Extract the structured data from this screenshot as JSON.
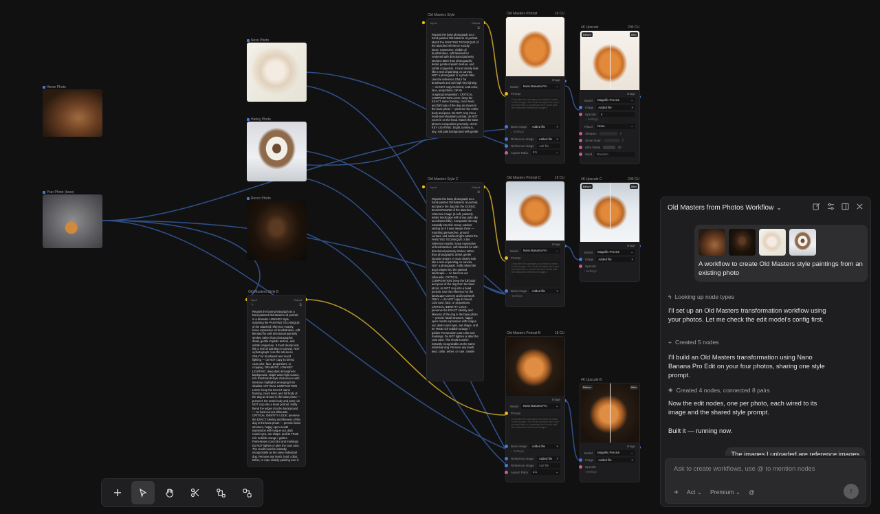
{
  "image_nodes": [
    {
      "id": "horse",
      "label": "Horse Photo"
    },
    {
      "id": "photo",
      "label": "Your Photo (base)"
    },
    {
      "id": "borzoi",
      "label": "Nexo Photo"
    },
    {
      "id": "sheltie",
      "label": "Harley Photo"
    },
    {
      "id": "boxer",
      "label": "Rocco Photo"
    }
  ],
  "style_nodes": [
    {
      "title": "Old Masters Style",
      "input_label": "Input",
      "output_label": "Output",
      "text": "Repaint the base photograph as a hand-painted Old Masters oil portrait. Match the PAINTING TECHNIQUE of the attached reference exactly: loose, expressive, visible oil brushstrokes, soft blended fur rendered with directional painterly strokes rather than photographic detail, gentle impasto texture, and subtle craquelure. It must clearly look like a real oil painting on canvas, NOT a photograph or a photo filter. Use the reference ONLY for brushwork and soft high-key lighting — do NOT copy its breed, coat color, face, proportions. OR its cropping/composition. CRITICAL COMPOSITION LOCK: keep the EXACT same framing, zoom level, and full body of the dog as shown in the base photo — preserve the entire body and pose. Do NOT crop into a head-and-shoulders portrait, do NOT zoom in on the head. Match the base photo's composition precisely. HIGH-KEY LIGHTING: bright, luminous, airy, soft pale background with gentle"
    },
    {
      "title": "Old Masters Style C",
      "input_label": "Input",
      "output_label": "Output",
      "text": "Repaint the base photograph as a hand-painted Old Masters oil portrait, and place the dog into the SCENIC BACKGROUND of the attached reference image (a soft, painterly winter landscape with snow, pale sky and distant hills). Composite the dog naturally into this snowy outdoor setting as if it was always there — matching perspective, ground contact, and ambient light. Match the PAINTING TECHNIQUE of the reference exactly: loose expressive oil brushstrokes, soft blended fur with directional painterly strokes rather than photographic detail, gentle impasto texture. It must clearly look like a real oil painting on canvas, NOT a photograph. Softly blend the dog's edges into the painted landscape — no hard cut-out silhouette. CRITICAL COMPOSITION: keep the full body and pose of the dog from the base photo; do NOT crop into a head portrait. Use the reference for the landscape scenery and brushwork ONLY — do NOT copy its breed, coat color, face, or proportions. CRITICAL IDENTITY LOCK: preserve the EXACT identity and likeness of the dog in the base photo — precise facial structure, happy open-mouth expression with tongue out, dark round eyes, ear shape, and its TRUE rich reddish-orange / golden Pomeranian coat color and markings. Do NOT lighten or alter the coat color. The result must be instantly recognizable as the same individual dog. Remove any leash, lead, collar, tether, or rope, cleanly painting over it."
    },
    {
      "title": "Old Masters Style B",
      "input_label": "Input",
      "output_label": "Output",
      "text": "Repaint the base photograph as a hand-painted Old Masters oil portrait in a dramatic LOW-KEY style, matching the PAINTING TECHNIQUE of the attached reference exactly: loose expressive oil brushstrokes, soft blended fur with directional painterly strokes rather than photographic detail, gentle impasto texture, and subtle craquelure. It must clearly look like a real oil painting on canvas, NOT a photograph. Use the reference ONLY for brushwork and mood lighting — do NOT copy its breed, coat color, face, proportions, or cropping. DRAMATIC LOW-KEY LIGHTING: deep dark atmospheric background, single warm light source, rich Rembrandt-style chiaroscuro with luminous highlights emerging from shadow. CRITICAL COMPOSITION LOCK: keep the EXACT same framing, zoom level, and full body of the dog as shown in the base photo — preserve the entire body and pose; do NOT crop into a head portrait. Softly blend the edges into the background — no hard cut-out silhouette. CRITICAL IDENTITY LOCK: preserve the EXACT identity and likeness of the dog in the base photo — precise facial structure, happy open-mouth expression with tongue out, dark round eyes, ear shape, and its TRUE rich reddish-orange / golden Pomeranian coat color and markings. Do NOT lighten or alter the coat color. The result must be instantly recognizable as the same individual dog. Remove any leash, lead, collar, tether, or rope cleanly painting over it."
    }
  ],
  "edit_nodes": [
    {
      "title": "Old Masters Portrait",
      "cost": "18 CU",
      "image_label": "Image",
      "model_label": "Model",
      "model": "Nano Banana Pro",
      "prompt_label": "Prompt",
      "prompt_placeholder": "Describe the changes you want to make to the image. The node accepts the input prompt from a connected text node and the attached reference images.",
      "base_label": "Base Image",
      "base_value": "Added file",
      "settings_label": "Settings",
      "ref1_label": "Reference Image",
      "ref1_value": "Added file",
      "ref2_label": "Reference Image",
      "ref2_value": "Add file",
      "aspect_label": "Aspect Ratio",
      "aspect_value": "1:1"
    },
    {
      "title": "Old Masters Portrait C",
      "cost": "18 CU",
      "image_label": "Image",
      "model_label": "Model",
      "model": "Nano Banana Pro",
      "prompt_label": "Prompt",
      "prompt_placeholder": "Describe the changes you want to make to the image. The node accepts the input prompt from a connected text node and the attached reference images.",
      "base_label": "Base Image",
      "base_value": "Added file",
      "settings_label": "Settings"
    },
    {
      "title": "Old Masters Portrait B",
      "cost": "18 CU",
      "image_label": "Image",
      "model_label": "Model",
      "model": "Nano Banana Pro",
      "prompt_label": "Prompt",
      "prompt_placeholder": "Describe the changes you want to make to the image. The node accepts the input prompt from a connected text node and the attached reference images.",
      "base_label": "Base Image",
      "base_value": "Added file",
      "settings_label": "Settings",
      "ref1_label": "Reference Image",
      "ref1_value": "Added file",
      "ref2_label": "Reference Image",
      "ref2_value": "Add file",
      "aspect_label": "Aspect Ratio",
      "aspect_value": "1:1"
    }
  ],
  "upscale_nodes": [
    {
      "title": "4K Upscale",
      "cost": "200 CU",
      "before": "Before",
      "after": "After",
      "image_label": "Image",
      "model_label": "Model",
      "model": "Magnific Precise",
      "input_label": "Image",
      "input_value": "Added file",
      "upscale_label": "Upscale",
      "upscale_value": "4",
      "settings_label": "Settings",
      "flavor_label": "Flavor",
      "flavor_value": "None",
      "sharpen_label": "Sharpen",
      "sharpen_value": "7",
      "smart_grain_label": "Smart Grain",
      "smart_grain_value": "7",
      "ultra_detail_label": "Ultra Detail",
      "ultra_detail_value": "30",
      "seed_label": "Seed",
      "seed_value": "Random"
    },
    {
      "title": "4K Upscale C",
      "cost": "200 CU",
      "before": "Before",
      "after": "After",
      "image_label": "Image",
      "model_label": "Model",
      "model": "Magnific Precise",
      "input_label": "Image",
      "input_value": "Added file",
      "upscale_label": "Upscale",
      "settings_label": "Settings"
    },
    {
      "title": "4K Upscale B",
      "cost": "",
      "before": "Before",
      "after": "After",
      "image_label": "Image",
      "model_label": "Model",
      "model": "Magnific Precise",
      "input_label": "Image",
      "input_value": "Added file",
      "upscale_label": "Upscale",
      "settings_label": "Settings"
    }
  ],
  "chat": {
    "title": "Old Masters from Photos Workflow",
    "user_message": "A workflow to create Old Masters style paintings from an existing photo",
    "step1": "Looking up node types",
    "msg1": "I'll set up an Old Masters transformation workflow using your photos. Let me check the edit model's config first.",
    "step2": "Created 5 nodes",
    "msg2": "I'll build an Old Masters transformation using Nano Banana Pro Edit on your four photos, sharing one style prompt.",
    "step3": "Created 4 nodes, connected 8 pairs",
    "msg3": "Now the edit nodes, one per photo, each wired to its image and the shared style prompt.",
    "msg4": "Built it — running now.",
    "peek": "The images I uploaded are reference images",
    "input_placeholder": "Ask to create workflows, use @ to mention nodes",
    "mode": "Act",
    "tier": "Premium"
  },
  "colors": {
    "wire_blue": "#2f4f86",
    "wire_yellow": "#b8962a",
    "accent_yellow": "#e8b923",
    "accent_blue": "#4a78d8",
    "accent_pink": "#c85a9a"
  }
}
